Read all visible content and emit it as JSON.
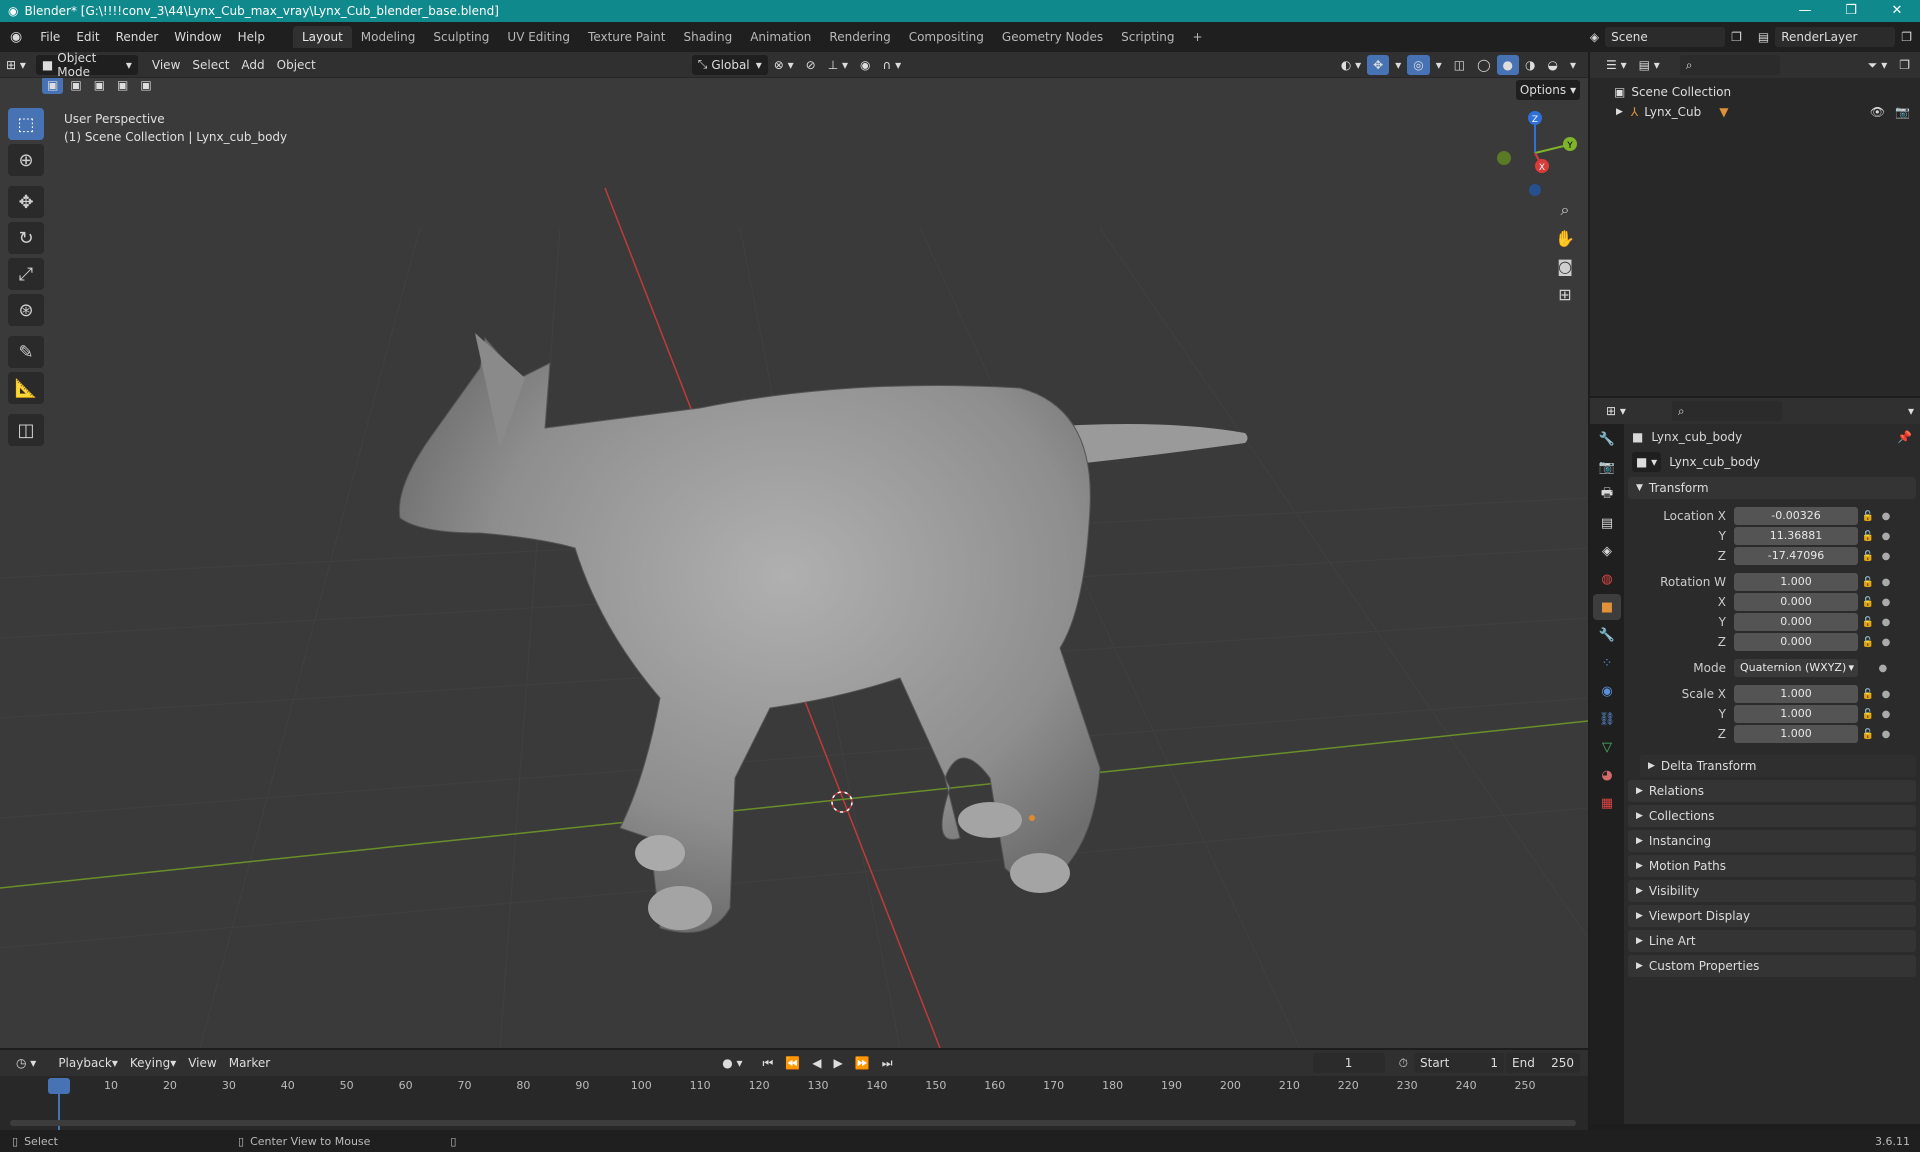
{
  "window": {
    "title": "Blender* [G:\\!!!!conv_3\\44\\Lynx_Cub_max_vray\\Lynx_Cub_blender_base.blend]",
    "buttons": [
      "—",
      "❐",
      "✕"
    ]
  },
  "menu": [
    "File",
    "Edit",
    "Render",
    "Window",
    "Help"
  ],
  "workspaces": {
    "tabs": [
      "Layout",
      "Modeling",
      "Sculpting",
      "UV Editing",
      "Texture Paint",
      "Shading",
      "Animation",
      "Rendering",
      "Compositing",
      "Geometry Nodes",
      "Scripting"
    ],
    "active": "Layout",
    "add": "+"
  },
  "scene": {
    "name": "Scene",
    "render_layer": "RenderLayer"
  },
  "viewport": {
    "mode": "Object Mode",
    "menus": [
      "View",
      "Select",
      "Add",
      "Object"
    ],
    "orientation": "Global",
    "options": "Options",
    "perspective": "User Perspective",
    "collection_info": "(1) Scene Collection | Lynx_cub_body",
    "gizmo": {
      "x": "X",
      "y": "Y",
      "z": "Z"
    }
  },
  "outliner": {
    "root": "Scene Collection",
    "items": [
      {
        "name": "Lynx_Cub"
      }
    ]
  },
  "properties": {
    "object_name": "Lynx_cub_body",
    "datablock": "Lynx_cub_body",
    "transform_title": "Transform",
    "location": {
      "label": "Location X",
      "x": "-0.00326",
      "y": "11.36881",
      "z": "-17.47096"
    },
    "rotation": {
      "label": "Rotation W",
      "w": "1.000",
      "x": "0.000",
      "y": "0.000",
      "z": "0.000"
    },
    "mode_label": "Mode",
    "mode_value": "Quaternion (WXYZ)",
    "scale": {
      "label": "Scale X",
      "x": "1.000",
      "y": "1.000",
      "z": "1.000"
    },
    "axis_labels": {
      "x": "X",
      "y": "Y",
      "z": "Z"
    },
    "delta_transform": "Delta Transform",
    "panels": [
      "Relations",
      "Collections",
      "Instancing",
      "Motion Paths",
      "Visibility",
      "Viewport Display",
      "Line Art",
      "Custom Properties"
    ]
  },
  "timeline": {
    "menus": [
      "Playback",
      "Keying",
      "View",
      "Marker"
    ],
    "current_frame": "1",
    "start_label": "Start",
    "start": "1",
    "end_label": "End",
    "end": "250",
    "ticks": [
      "1",
      "10",
      "20",
      "30",
      "40",
      "50",
      "60",
      "70",
      "80",
      "90",
      "100",
      "110",
      "120",
      "130",
      "140",
      "150",
      "160",
      "170",
      "180",
      "190",
      "200",
      "210",
      "220",
      "230",
      "240",
      "250"
    ]
  },
  "status": {
    "left": "Select",
    "middle": "Center View to Mouse",
    "version": "3.6.11"
  }
}
